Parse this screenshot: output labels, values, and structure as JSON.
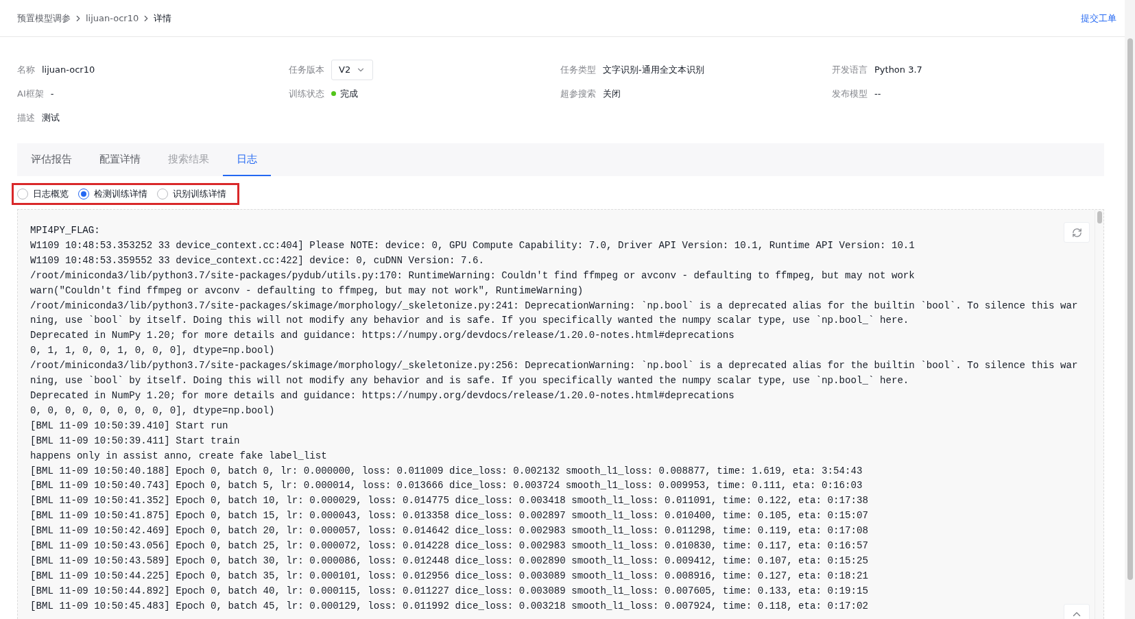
{
  "breadcrumb": [
    {
      "label": "预置模型调参",
      "current": false
    },
    {
      "label": "lijuan-ocr10",
      "current": false
    },
    {
      "label": "详情",
      "current": true
    }
  ],
  "header_action": "提交工单",
  "info": [
    [
      {
        "kind": "text",
        "label": "名称",
        "value": "lijuan-ocr10"
      },
      {
        "kind": "select",
        "label": "任务版本",
        "value": "V2"
      },
      {
        "kind": "text",
        "label": "任务类型",
        "value": "文字识别-通用全文本识别"
      },
      {
        "kind": "text",
        "label": "开发语言",
        "value": "Python 3.7"
      }
    ],
    [
      {
        "kind": "text",
        "label": "AI框架",
        "value": "-"
      },
      {
        "kind": "status",
        "label": "训练状态",
        "value": "完成",
        "color": "#52c41a"
      },
      {
        "kind": "text",
        "label": "超参搜索",
        "value": "关闭"
      },
      {
        "kind": "text",
        "label": "发布模型",
        "value": "--"
      }
    ],
    [
      {
        "kind": "text",
        "label": "描述",
        "value": "测试"
      }
    ]
  ],
  "tabs": [
    {
      "label": "评估报告",
      "selected": false,
      "disabled": false
    },
    {
      "label": "配置详情",
      "selected": false,
      "disabled": false
    },
    {
      "label": "搜索结果",
      "selected": false,
      "disabled": true
    },
    {
      "label": "日志",
      "selected": true,
      "disabled": false
    }
  ],
  "log_views": [
    {
      "label": "日志概览",
      "selected": false
    },
    {
      "label": "检测训练详情",
      "selected": true
    },
    {
      "label": "识别训练详情",
      "selected": false
    }
  ],
  "log_lines": [
    "MPI4PY_FLAG:",
    "W1109 10:48:53.353252 33 device_context.cc:404] Please NOTE: device: 0, GPU Compute Capability: 7.0, Driver API Version: 10.1, Runtime API Version: 10.1",
    "W1109 10:48:53.359552 33 device_context.cc:422] device: 0, cuDNN Version: 7.6.",
    "/root/miniconda3/lib/python3.7/site-packages/pydub/utils.py:170: RuntimeWarning: Couldn't find ffmpeg or avconv - defaulting to ffmpeg, but may not work",
    "warn(\"Couldn't find ffmpeg or avconv - defaulting to ffmpeg, but may not work\", RuntimeWarning)",
    "/root/miniconda3/lib/python3.7/site-packages/skimage/morphology/_skeletonize.py:241: DeprecationWarning: `np.bool` is a deprecated alias for the builtin `bool`. To silence this war",
    "ning, use `bool` by itself. Doing this will not modify any behavior and is safe. If you specifically wanted the numpy scalar type, use `np.bool_` here.",
    "Deprecated in NumPy 1.20; for more details and guidance: https://numpy.org/devdocs/release/1.20.0-notes.html#deprecations",
    "0, 1, 1, 0, 0, 1, 0, 0, 0], dtype=np.bool)",
    "/root/miniconda3/lib/python3.7/site-packages/skimage/morphology/_skeletonize.py:256: DeprecationWarning: `np.bool` is a deprecated alias for the builtin `bool`. To silence this war",
    "ning, use `bool` by itself. Doing this will not modify any behavior and is safe. If you specifically wanted the numpy scalar type, use `np.bool_` here.",
    "Deprecated in NumPy 1.20; for more details and guidance: https://numpy.org/devdocs/release/1.20.0-notes.html#deprecations",
    "0, 0, 0, 0, 0, 0, 0, 0, 0], dtype=np.bool)",
    "[BML 11-09 10:50:39.410] Start run",
    "[BML 11-09 10:50:39.411] Start train",
    "happens only in assist anno, create fake label_list",
    "[BML 11-09 10:50:40.188] Epoch 0, batch 0, lr: 0.000000, loss: 0.011009 dice_loss: 0.002132 smooth_l1_loss: 0.008877, time: 1.619, eta: 3:54:43",
    "[BML 11-09 10:50:40.743] Epoch 0, batch 5, lr: 0.000014, loss: 0.013666 dice_loss: 0.003724 smooth_l1_loss: 0.009953, time: 0.111, eta: 0:16:03",
    "[BML 11-09 10:50:41.352] Epoch 0, batch 10, lr: 0.000029, loss: 0.014775 dice_loss: 0.003418 smooth_l1_loss: 0.011091, time: 0.122, eta: 0:17:38",
    "[BML 11-09 10:50:41.875] Epoch 0, batch 15, lr: 0.000043, loss: 0.013358 dice_loss: 0.002897 smooth_l1_loss: 0.010400, time: 0.105, eta: 0:15:07",
    "[BML 11-09 10:50:42.469] Epoch 0, batch 20, lr: 0.000057, loss: 0.014642 dice_loss: 0.002983 smooth_l1_loss: 0.011298, time: 0.119, eta: 0:17:08",
    "[BML 11-09 10:50:43.056] Epoch 0, batch 25, lr: 0.000072, loss: 0.014228 dice_loss: 0.002983 smooth_l1_loss: 0.010830, time: 0.117, eta: 0:16:57",
    "[BML 11-09 10:50:43.589] Epoch 0, batch 30, lr: 0.000086, loss: 0.012448 dice_loss: 0.002890 smooth_l1_loss: 0.009412, time: 0.107, eta: 0:15:25",
    "[BML 11-09 10:50:44.225] Epoch 0, batch 35, lr: 0.000101, loss: 0.012956 dice_loss: 0.003089 smooth_l1_loss: 0.008916, time: 0.127, eta: 0:18:21",
    "[BML 11-09 10:50:44.892] Epoch 0, batch 40, lr: 0.000115, loss: 0.011227 dice_loss: 0.003089 smooth_l1_loss: 0.007605, time: 0.133, eta: 0:19:15",
    "[BML 11-09 10:50:45.483] Epoch 0, batch 45, lr: 0.000129, loss: 0.011992 dice_loss: 0.003218 smooth_l1_loss: 0.007924, time: 0.118, eta: 0:17:02"
  ]
}
